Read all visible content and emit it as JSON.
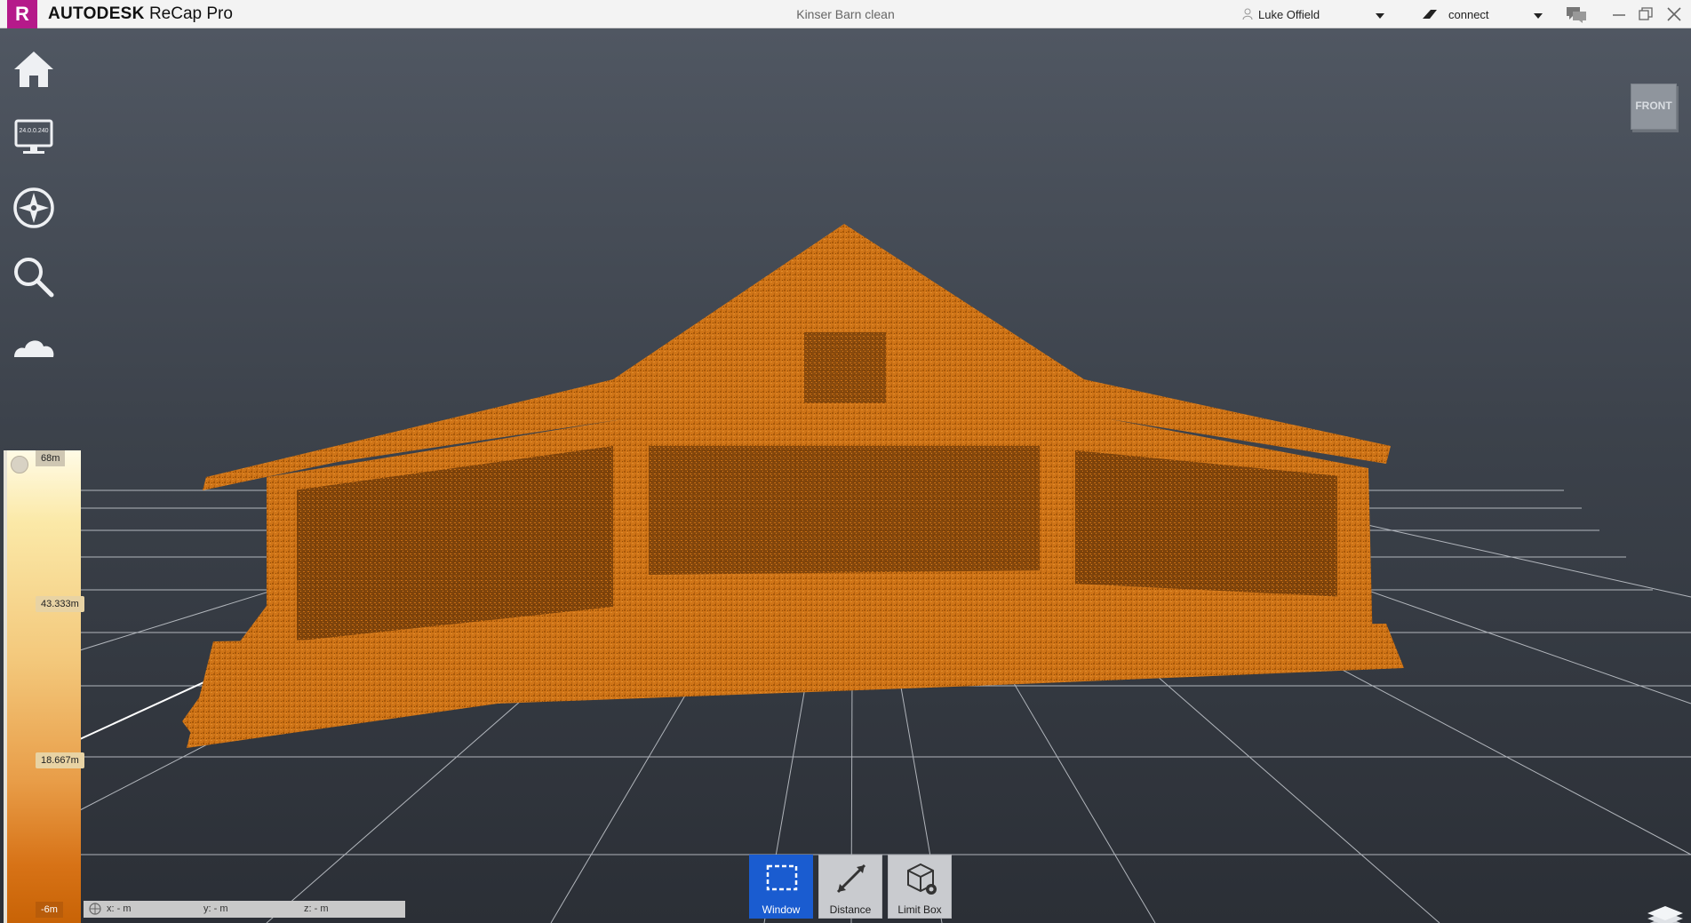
{
  "app": {
    "logo_letter": "R",
    "brand": "AUTODESK",
    "product": "ReCap Pro",
    "document_title": "Kinser Barn clean",
    "accent_color": "#b51a8a"
  },
  "account": {
    "user_name": "Luke Offield",
    "connect_label": "connect"
  },
  "window_controls": [
    "minimize-icon",
    "restore-icon",
    "close-icon"
  ],
  "left_tools": [
    {
      "name": "home-icon"
    },
    {
      "name": "display-settings-icon",
      "label": "24.0.0.240"
    },
    {
      "name": "navigation-compass-icon"
    },
    {
      "name": "search-icon"
    },
    {
      "name": "cloud-icon"
    }
  ],
  "legend": {
    "max": "68m",
    "upper": "43.333m",
    "lower": "18.667m",
    "min": "-6m"
  },
  "coords": {
    "x": "x:  - m",
    "y": "y:  - m",
    "z": "z:  - m"
  },
  "toolbar": {
    "window_label": "Window",
    "distance_label": "Distance",
    "limit_box_label": "Limit Box",
    "active_color": "#1a5cd0"
  },
  "viewcube": {
    "face": "FRONT"
  },
  "point_cloud_color": "#d07418"
}
